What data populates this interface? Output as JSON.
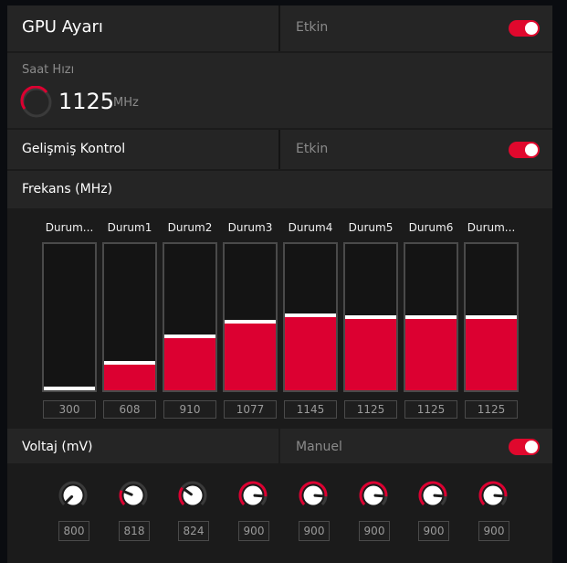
{
  "header": {
    "title": "GPU Ayarı",
    "status": "Etkin",
    "toggle_on": true
  },
  "clock": {
    "label": "Saat Hızı",
    "value": "1125",
    "unit": "MHz"
  },
  "advanced": {
    "title": "Gelişmiş Kontrol",
    "status": "Etkin",
    "toggle_on": true
  },
  "frequency": {
    "title": "Frekans (MHz)",
    "states": [
      {
        "label": "Durum...",
        "value": "300",
        "level": 0.0
      },
      {
        "label": "Durum1",
        "value": "608",
        "level": 0.19
      },
      {
        "label": "Durum2",
        "value": "910",
        "level": 0.37
      },
      {
        "label": "Durum3",
        "value": "1077",
        "level": 0.47
      },
      {
        "label": "Durum4",
        "value": "1145",
        "level": 0.51
      },
      {
        "label": "Durum5",
        "value": "1125",
        "level": 0.5
      },
      {
        "label": "Durum6",
        "value": "1125",
        "level": 0.5
      },
      {
        "label": "Durum...",
        "value": "1125",
        "level": 0.5
      }
    ]
  },
  "voltage": {
    "title": "Voltaj (mV)",
    "mode": "Manuel",
    "toggle_on": true,
    "knobs": [
      {
        "value": "800",
        "level": 0.0
      },
      {
        "value": "818",
        "level": 0.25
      },
      {
        "value": "824",
        "level": 0.3
      },
      {
        "value": "900",
        "level": 0.85
      },
      {
        "value": "900",
        "level": 0.85
      },
      {
        "value": "900",
        "level": 0.85
      },
      {
        "value": "900",
        "level": 0.85
      },
      {
        "value": "900",
        "level": 0.85
      }
    ]
  },
  "colors": {
    "accent": "#dc0031",
    "panel": "#252525",
    "track": "#3a3a3a"
  }
}
